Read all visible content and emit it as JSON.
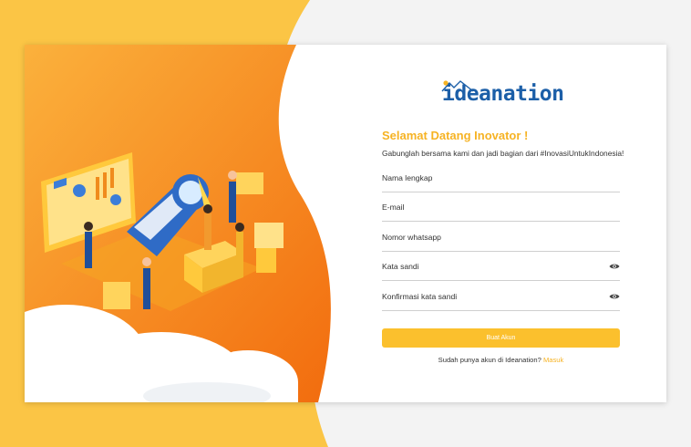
{
  "brand": {
    "name": "ideanation"
  },
  "form": {
    "title": "Selamat Datang Inovator !",
    "subtitle": "Gabunglah bersama kami dan jadi bagian dari #InovasiUntukIndonesia!",
    "fields": [
      {
        "label": "Nama lengkap",
        "icon": null
      },
      {
        "label": "E-mail",
        "icon": null
      },
      {
        "label": "Nomor whatsapp",
        "icon": null
      },
      {
        "label": "Kata sandi",
        "icon": "eye-icon"
      },
      {
        "label": "Konfirmasi kata sandi",
        "icon": "eye-icon"
      }
    ],
    "submit_label": "Buat Akun",
    "login_prompt": "Sudah punya akun di Ideanation?",
    "login_link": "Masuk"
  },
  "colors": {
    "accent": "#fbc02d",
    "title": "#f6b324",
    "brand": "#1c5fa8",
    "orange": "#f7941d",
    "page_bg": "#f3f3f3"
  }
}
